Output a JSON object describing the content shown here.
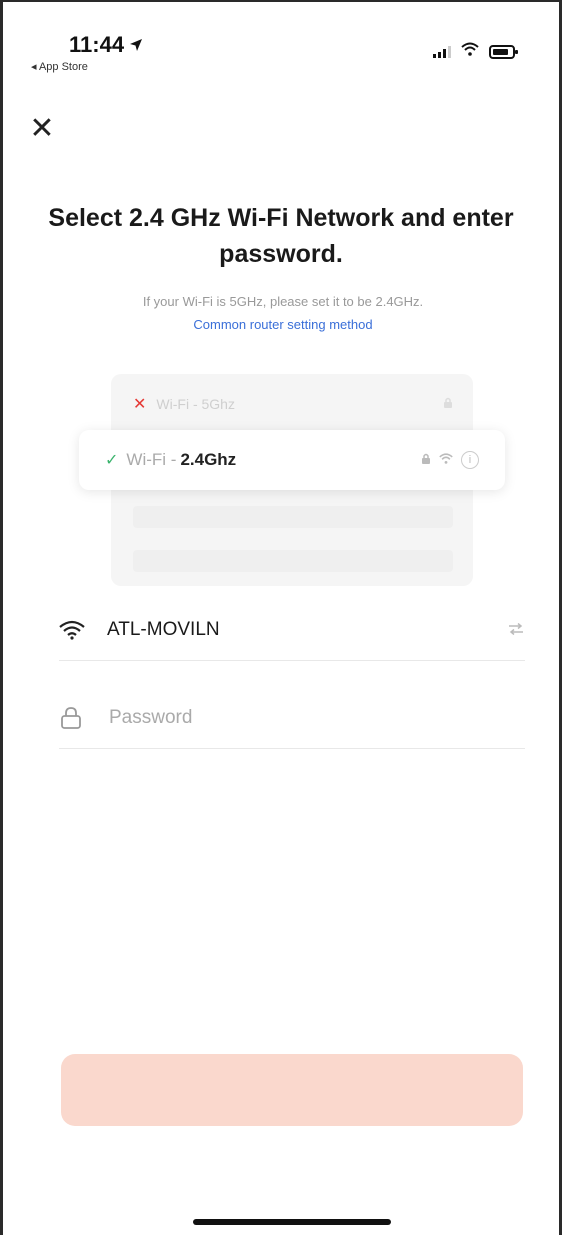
{
  "status_bar": {
    "time": "11:44",
    "back_app": "◂ App Store"
  },
  "header": {
    "close_glyph": "✕"
  },
  "title": "Select 2.4 GHz Wi-Fi Network and enter password.",
  "hint": "If your Wi-Fi is 5GHz, please set it to be 2.4GHz.",
  "hint_link": "Common router setting method",
  "illustration": {
    "row_5g_label": "Wi-Fi - 5Ghz",
    "row_24g_prefix": "Wi-Fi -",
    "row_24g_band": "2.4Ghz",
    "mark_bad": "✕",
    "mark_good": "✓"
  },
  "form": {
    "ssid_value": "ATL-MOVILN",
    "password_placeholder": "Password",
    "password_value": ""
  },
  "next_button": {
    "label": ""
  },
  "colors": {
    "accent": "#3a6fd8",
    "button_disabled": "#fad8cd",
    "check_green": "#3cb46e",
    "x_red": "#e53935"
  },
  "icons": [
    "location-arrow-icon",
    "signal-icon",
    "wifi-icon",
    "battery-icon",
    "close-icon",
    "lock-icon",
    "info-icon",
    "switch-network-icon"
  ]
}
